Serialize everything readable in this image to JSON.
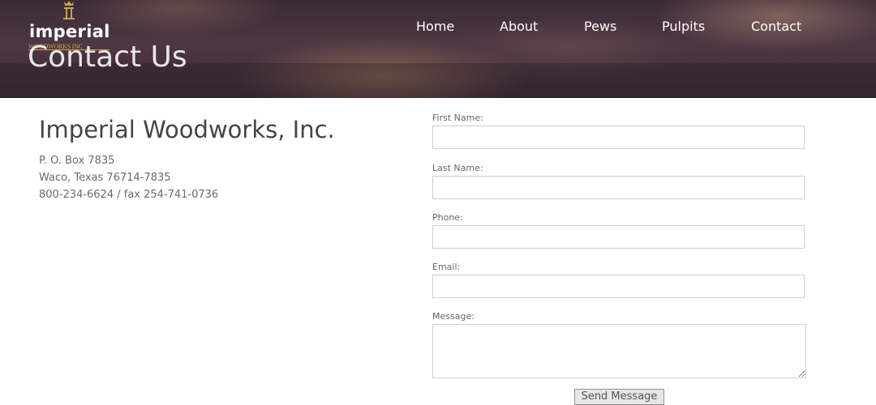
{
  "logo": {
    "word": "imperial",
    "sub": "WOODWORKS INC",
    "mark": "pillar-crown-icon",
    "gold": "#c9a44c"
  },
  "nav": {
    "items": [
      {
        "label": "Home"
      },
      {
        "label": "About"
      },
      {
        "label": "Pews"
      },
      {
        "label": "Pulpits"
      },
      {
        "label": "Contact"
      }
    ]
  },
  "hero": {
    "title": "Contact Us"
  },
  "company": {
    "name": "Imperial Woodworks, Inc.",
    "address_line1": "P. O. Box 7835",
    "address_line2": "Waco, Texas 76714-7835",
    "phone_fax": "800-234-6624 / fax 254-741-0736"
  },
  "form": {
    "first_name": {
      "label": "First Name:",
      "value": ""
    },
    "last_name": {
      "label": "Last Name:",
      "value": ""
    },
    "phone": {
      "label": "Phone:",
      "value": ""
    },
    "email": {
      "label": "Email:",
      "value": ""
    },
    "message": {
      "label": "Message:",
      "value": ""
    },
    "submit_label": "Send Message"
  }
}
